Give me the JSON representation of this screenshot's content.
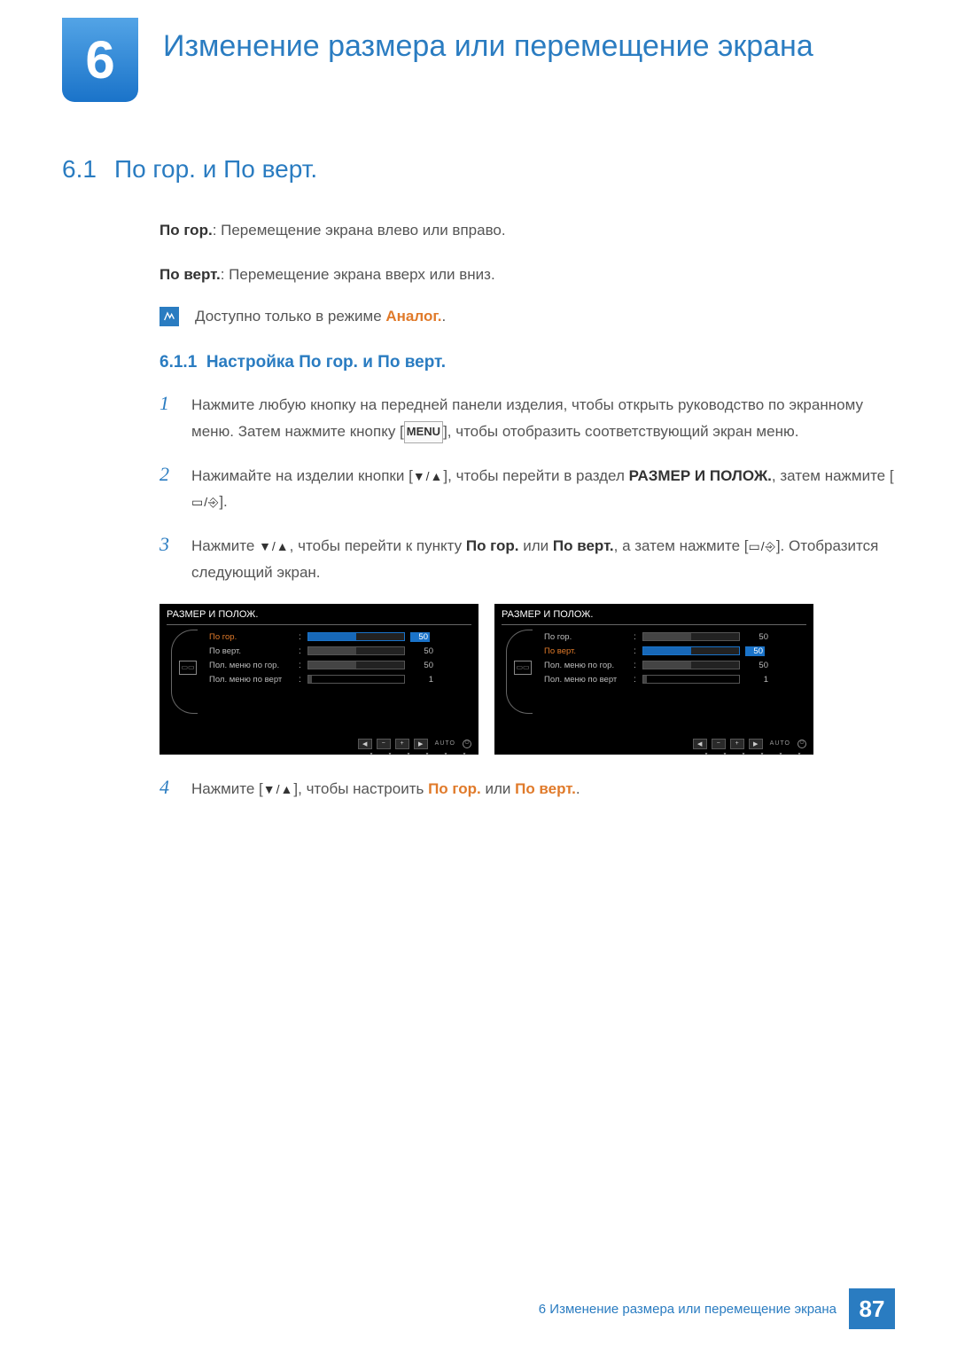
{
  "chapter": {
    "number": "6",
    "title": "Изменение размера или перемещение экрана"
  },
  "section": {
    "number": "6.1",
    "title": "По гор. и По верт."
  },
  "intro": {
    "line1_b": "По гор.",
    "line1": ": Перемещение экрана влево или вправо.",
    "line2_b": "По верт.",
    "line2": ": Перемещение экрана вверх или вниз."
  },
  "note": {
    "prefix": "Доступно только в режиме ",
    "highlight": "Аналог.",
    "suffix": "."
  },
  "subsection": {
    "number": "6.1.1",
    "title": "Настройка По гор. и По верт."
  },
  "steps": {
    "s1": {
      "num": "1",
      "pre": "Нажмите любую кнопку на передней панели изделия, чтобы открыть руководство по экранному меню. Затем нажмите кнопку [",
      "menu": "MENU",
      "post": "], чтобы отобразить соответствующий экран меню."
    },
    "s2": {
      "num": "2",
      "a": "Нажимайте на изделии кнопки [",
      "b": "], чтобы перейти в раздел ",
      "section": "РАЗМЕР И ПОЛОЖ.",
      "c": ", затем нажмите [",
      "d": "]."
    },
    "s3": {
      "num": "3",
      "a": "Нажмите ",
      "b": ", чтобы перейти к пункту ",
      "h1": "По гор.",
      "or": " или ",
      "h2": "По верт.",
      "c": ", а затем нажмите [",
      "d": "]. Отобразится следующий экран."
    },
    "s4": {
      "num": "4",
      "a": "Нажмите [",
      "b": "], чтобы настроить ",
      "h1": "По гор.",
      "or": " или ",
      "h2": "По верт.",
      "tail": "."
    }
  },
  "osd": {
    "title": "РАЗМЕР И ПОЛОЖ.",
    "rows": [
      {
        "label": "По гор.",
        "value": "50",
        "fill": 50
      },
      {
        "label": "По верт.",
        "value": "50",
        "fill": 50
      },
      {
        "label": "Пол. меню по гор.",
        "value": "50",
        "fill": 50
      },
      {
        "label": "Пол. меню по верт",
        "value": "1",
        "fill": 4
      }
    ],
    "footer": {
      "auto": "AUTO"
    }
  },
  "footer": {
    "text": "6 Изменение размера или перемещение экрана",
    "page": "87"
  }
}
